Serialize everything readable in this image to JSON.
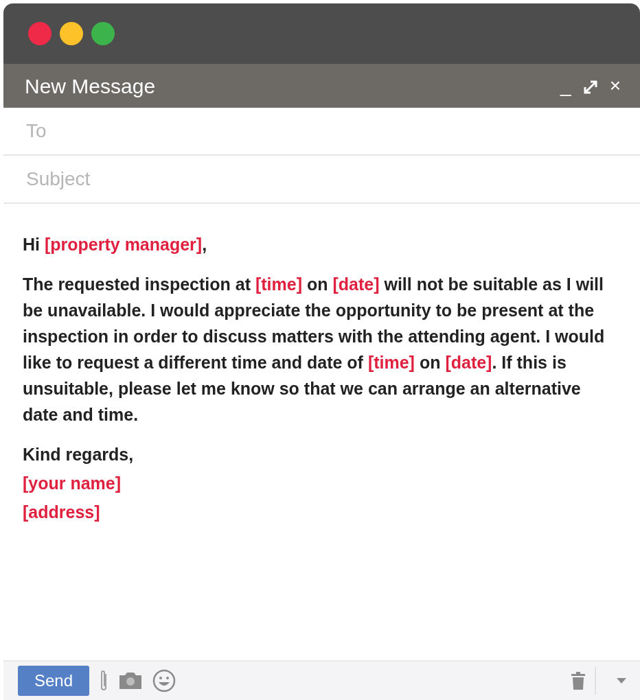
{
  "window": {
    "title": "New Message",
    "controls": [
      {
        "kind": "minimize",
        "label": "_"
      },
      {
        "kind": "expand"
      },
      {
        "kind": "close",
        "label": "×"
      }
    ]
  },
  "fields": [
    {
      "placeholder": "To"
    },
    {
      "placeholder": "Subject"
    }
  ],
  "body": [
    [
      {
        "text": "Hi ",
        "placeholder": false
      },
      {
        "text": "[property manager]",
        "placeholder": true
      },
      {
        "text": ",",
        "placeholder": false
      }
    ],
    [
      {
        "text": "The requested inspection at ",
        "placeholder": false
      },
      {
        "text": "[time]",
        "placeholder": true
      },
      {
        "text": " on ",
        "placeholder": false
      },
      {
        "text": "[date]",
        "placeholder": true
      },
      {
        "text": " will not be suitable as I will be unavailable. I would appreciate the opportunity to be present at the inspection in order to discuss matters with the attending agent. I would like to request a different time and date of ",
        "placeholder": false
      },
      {
        "text": "[time]",
        "placeholder": true
      },
      {
        "text": " on ",
        "placeholder": false
      },
      {
        "text": "[date]",
        "placeholder": true
      },
      {
        "text": ". If this is unsuitable, please let me know so that we can arrange an alternative date and time.",
        "placeholder": false
      }
    ],
    [
      {
        "text": "Kind regards,",
        "placeholder": false
      }
    ],
    [
      {
        "text": "[your name]",
        "placeholder": true
      }
    ],
    [
      {
        "text": "[address]",
        "placeholder": true
      }
    ]
  ],
  "toolbar": {
    "send": "Send"
  }
}
